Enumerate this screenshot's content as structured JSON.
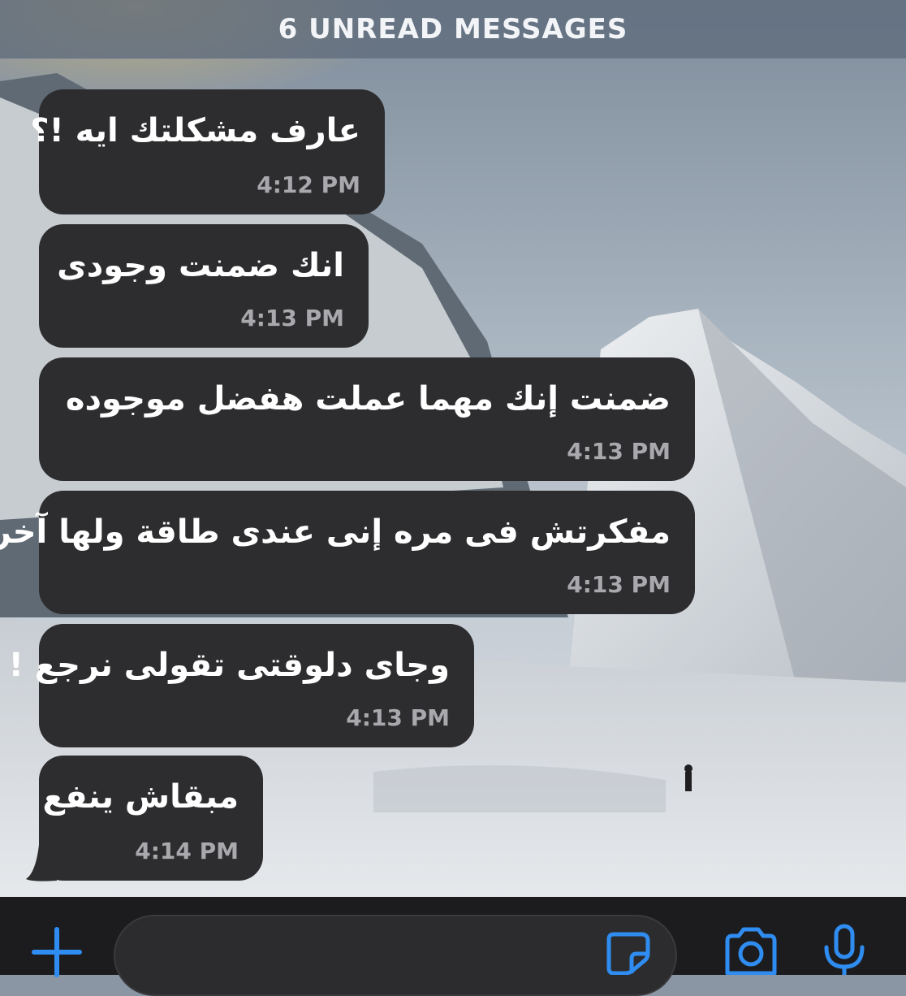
{
  "header": {
    "unread_label": "6 UNREAD MESSAGES"
  },
  "messages": [
    {
      "text": "عارف مشكلتك ايه !؟",
      "time": "4:12 PM"
    },
    {
      "text": "انك ضمنت وجودى",
      "time": "4:13 PM"
    },
    {
      "text": "ضمنت إنك مهما عملت هفضل موجوده",
      "time": "4:13 PM"
    },
    {
      "text": "مفكرتش فى مره إنى عندى طاقة ولها آخر",
      "time": "4:13 PM"
    },
    {
      "text": "وجاى دلوقتى تقولى نرجع !",
      "time": "4:13 PM"
    },
    {
      "text": "مبقاش ينفع",
      "time": "4:14 PM"
    }
  ],
  "composer": {
    "placeholder": ""
  },
  "icons": {
    "attach": "plus-icon",
    "sticker": "sticker-icon",
    "camera": "camera-icon",
    "mic": "microphone-icon"
  },
  "colors": {
    "bubble": "#2d2d2f",
    "accent": "#2f8cf0",
    "timestamp": "#a9a9ad"
  }
}
